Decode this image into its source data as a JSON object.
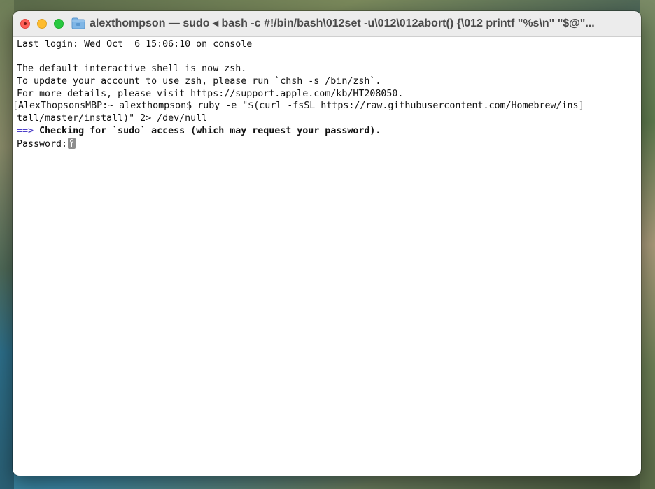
{
  "window": {
    "title": "alexthompson — sudo ◂ bash -c #!/bin/bash\\012set -u\\012\\012abort() {\\012  printf \"%s\\n\" \"$@\"..."
  },
  "terminal": {
    "lines": {
      "l0": "Last login: Wed Oct  6 15:06:10 on console",
      "l1": "",
      "l2": "The default interactive shell is now zsh.",
      "l3": "To update your account to use zsh, please run `chsh -s /bin/zsh`.",
      "l4": "For more details, please visit https://support.apple.com/kb/HT208050.",
      "l5_prompt": "AlexThopsonsMBP:~ alexthompson$ ruby -e \"$(curl -fsSL https://raw.githubusercontent.com/Homebrew/ins",
      "l6": "tall/master/install)\" 2> /dev/null",
      "l7_arrow": "==>",
      "l7_text": " Checking for `sudo` access (which may request your password).",
      "l8": "Password:"
    },
    "bracket_left": "[",
    "bracket_right": "]"
  },
  "colors": {
    "arrow": "#4d3fc9",
    "close": "#ff5f57",
    "minimize": "#febc2e",
    "maximize": "#28c840"
  },
  "icons": [
    "close-icon",
    "minimize-icon",
    "maximize-icon",
    "folder-icon",
    "key-cursor-icon"
  ]
}
